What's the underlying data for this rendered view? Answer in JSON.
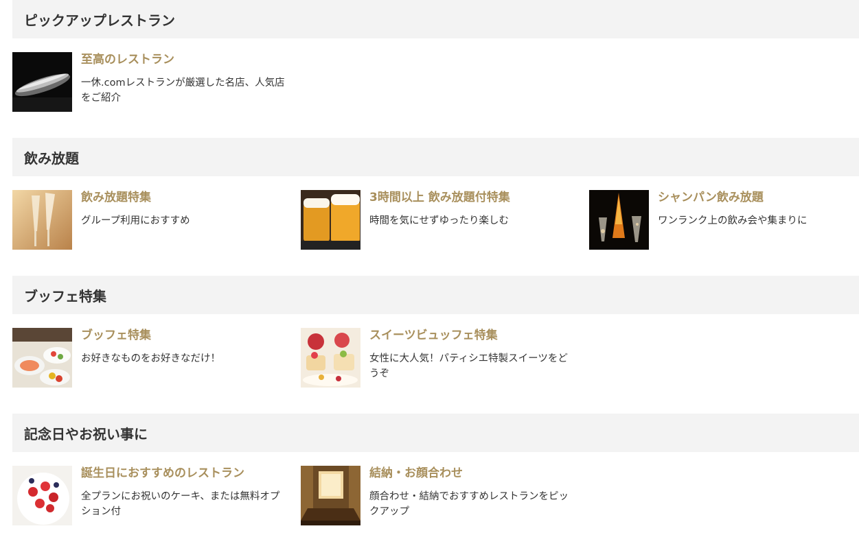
{
  "colors": {
    "accent": "#a88f5c",
    "header_bg": "#f3f3f3",
    "text": "#333333"
  },
  "sections": [
    {
      "title": "ピックアップレストラン",
      "items": [
        {
          "title": "至高のレストラン",
          "desc": "一休.comレストランが厳選した名店、人気店をご紹介",
          "icon": "fish-dish-photo"
        }
      ]
    },
    {
      "title": "飲み放題",
      "items": [
        {
          "title": "飲み放題特集",
          "desc": "グループ利用におすすめ",
          "icon": "champagne-glasses-photo"
        },
        {
          "title": "3時間以上 飲み放題付特集",
          "desc": "時間を気にせずゆったり楽しむ",
          "icon": "beer-mugs-photo"
        },
        {
          "title": "シャンパン飲み放題",
          "desc": "ワンランク上の飲み会や集まりに",
          "icon": "tower-champagne-photo"
        }
      ]
    },
    {
      "title": "ブッフェ特集",
      "items": [
        {
          "title": "ブッフェ特集",
          "desc": "お好きなものをお好きなだけ！",
          "icon": "buffet-food-photo"
        },
        {
          "title": "スイーツビュッフェ特集",
          "desc": "女性に大人気！パティシエ特製スイーツをどうぞ",
          "icon": "sweets-photo"
        }
      ]
    },
    {
      "title": "記念日やお祝い事に",
      "items": [
        {
          "title": "誕生日におすすめのレストラン",
          "desc": "全プランにお祝いのケーキ、または無料オプション付",
          "icon": "strawberry-cake-photo"
        },
        {
          "title": "結納・お顔合わせ",
          "desc": "顔合わせ・結納でおすすめレストランをピックアップ",
          "icon": "private-room-photo"
        }
      ]
    }
  ]
}
